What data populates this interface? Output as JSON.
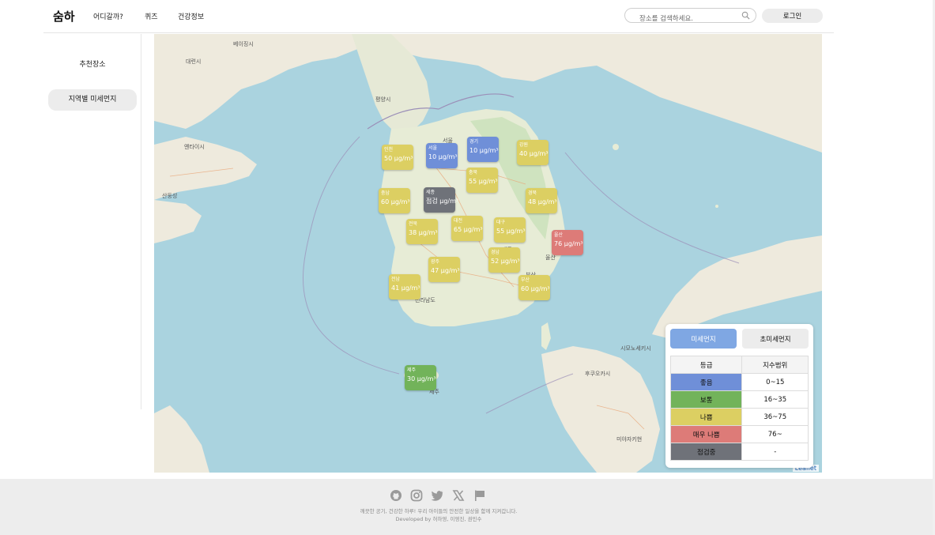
{
  "header": {
    "logo": "숨하",
    "nav": [
      "어디갈까?",
      "퀴즈",
      "건강정보"
    ],
    "search_placeholder": "장소를 검색하세요.",
    "login_label": "로그인"
  },
  "sidebar": {
    "items": [
      {
        "label": "추천장소",
        "active": false
      },
      {
        "label": "지역별 미세먼지",
        "active": true
      }
    ]
  },
  "map": {
    "attribution": "Leaflet",
    "places": [
      "대련시",
      "베이징시",
      "평양시",
      "서울",
      "대전",
      "광주",
      "부산",
      "제주",
      "옌타이시",
      "산둥성",
      "대구",
      "전라남도",
      "울산",
      "시모노세키시",
      "후쿠오카시",
      "미야자키현"
    ],
    "markers": [
      {
        "region": "인천",
        "value": "50 μg/m³",
        "grade": "나쁨"
      },
      {
        "region": "서울",
        "value": "10 μg/m³",
        "grade": "좋음"
      },
      {
        "region": "경기",
        "value": "10 μg/m³",
        "grade": "좋음"
      },
      {
        "region": "강원",
        "value": "40 μg/m³",
        "grade": "나쁨"
      },
      {
        "region": "충북",
        "value": "55 μg/m³",
        "grade": "나쁨"
      },
      {
        "region": "충남",
        "value": "60 μg/m³",
        "grade": "나쁨"
      },
      {
        "region": "세종",
        "value": "점검 μg/m³",
        "grade": "점검중"
      },
      {
        "region": "경북",
        "value": "48 μg/m³",
        "grade": "나쁨"
      },
      {
        "region": "전북",
        "value": "38 μg/m³",
        "grade": "나쁨"
      },
      {
        "region": "대전",
        "value": "65 μg/m³",
        "grade": "나쁨"
      },
      {
        "region": "대구",
        "value": "55 μg/m³",
        "grade": "나쁨"
      },
      {
        "region": "울산",
        "value": "76 μg/m³",
        "grade": "매우 나쁨"
      },
      {
        "region": "경남",
        "value": "52 μg/m³",
        "grade": "나쁨"
      },
      {
        "region": "광주",
        "value": "47 μg/m³",
        "grade": "나쁨"
      },
      {
        "region": "전남",
        "value": "41 μg/m³",
        "grade": "나쁨"
      },
      {
        "region": "부산",
        "value": "60 μg/m³",
        "grade": "나쁨"
      },
      {
        "region": "제주",
        "value": "30 μg/m³",
        "grade": "보통"
      }
    ]
  },
  "legend": {
    "tabs": [
      "미세먼지",
      "초미세먼지"
    ],
    "headers": [
      "등급",
      "지수범위"
    ],
    "rows": [
      {
        "grade": "좋음",
        "range": "0~15",
        "color": "#6f8fd8"
      },
      {
        "grade": "보통",
        "range": "16~35",
        "color": "#72b35a"
      },
      {
        "grade": "나쁨",
        "range": "36~75",
        "color": "#dccf62"
      },
      {
        "grade": "매우 나쁨",
        "range": "76~",
        "color": "#dd7b78"
      },
      {
        "grade": "점검중",
        "range": "-",
        "color": "#6f7279"
      }
    ]
  },
  "grade_colors": {
    "좋음": "#6f8fd8",
    "보통": "#72b35a",
    "나쁨": "#dccf62",
    "매우 나쁨": "#dd7b78",
    "점검중": "#6f7279"
  },
  "footer": {
    "icons": [
      "github-icon",
      "instagram-icon",
      "twitter-icon",
      "x-icon",
      "flag-icon"
    ],
    "line1": "깨끗한 공기, 건강한 하루! 우리 아이들의 안전한 일상을 함께 지켜갑니다.",
    "line2": "Developed by 허하영, 이영진, 권민수"
  }
}
